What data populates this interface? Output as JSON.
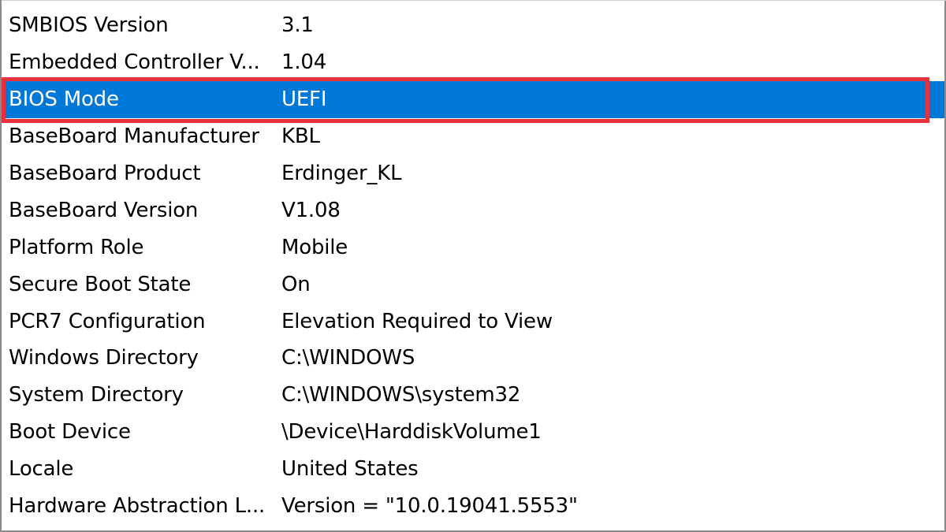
{
  "rows": [
    {
      "item": "SMBIOS Version",
      "value": "3.1"
    },
    {
      "item": "Embedded Controller V...",
      "value": "1.04"
    },
    {
      "item": "BIOS Mode",
      "value": "UEFI"
    },
    {
      "item": "BaseBoard Manufacturer",
      "value": "KBL"
    },
    {
      "item": "BaseBoard Product",
      "value": "Erdinger_KL"
    },
    {
      "item": "BaseBoard Version",
      "value": "V1.08"
    },
    {
      "item": "Platform Role",
      "value": "Mobile"
    },
    {
      "item": "Secure Boot State",
      "value": "On"
    },
    {
      "item": "PCR7 Configuration",
      "value": "Elevation Required to View"
    },
    {
      "item": "Windows Directory",
      "value": "C:\\WINDOWS"
    },
    {
      "item": "System Directory",
      "value": "C:\\WINDOWS\\system32"
    },
    {
      "item": "Boot Device",
      "value": "\\Device\\HarddiskVolume1"
    },
    {
      "item": "Locale",
      "value": "United States"
    },
    {
      "item": "Hardware Abstraction L...",
      "value": "Version = \"10.0.19041.5553\""
    }
  ],
  "selected_row": "BIOS Mode",
  "colors": {
    "selection": "#0078d7",
    "annotation": "#e8313f"
  }
}
